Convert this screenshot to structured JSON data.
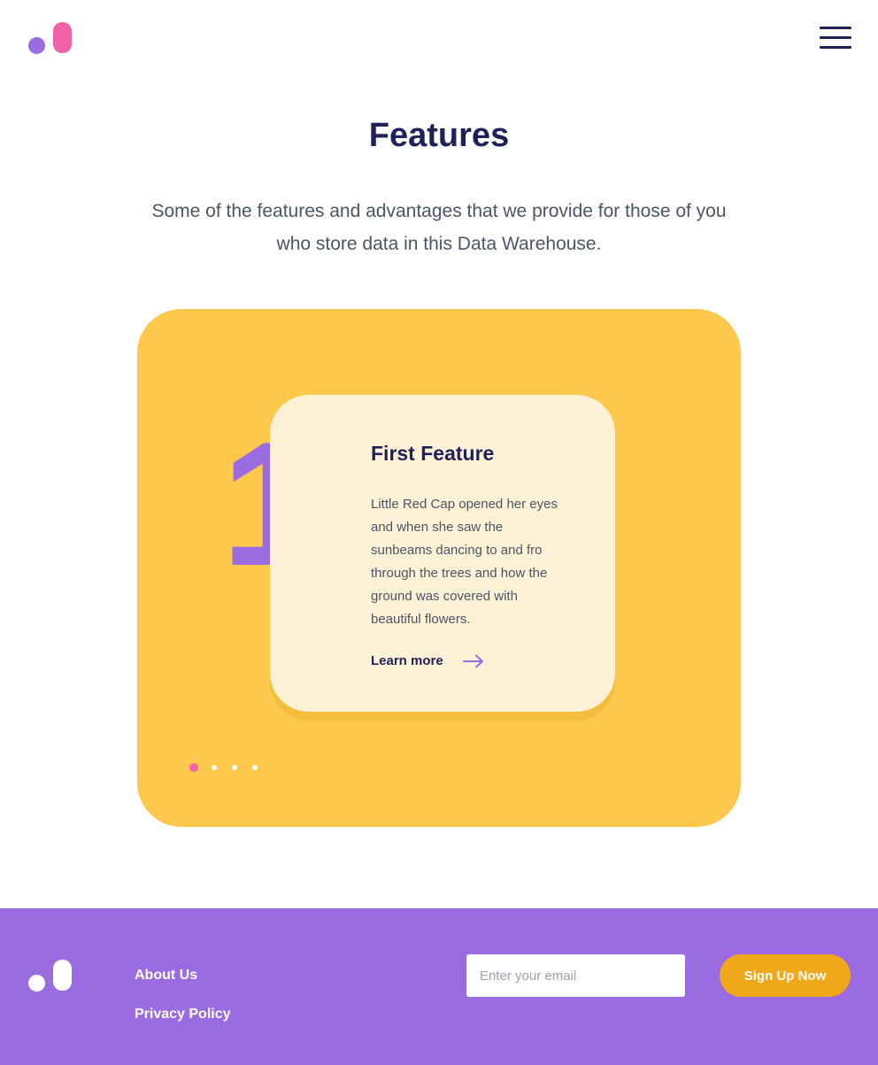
{
  "header": {
    "logo_icon": "brand-logo-icon",
    "menu_icon": "hamburger-menu-icon"
  },
  "features": {
    "title": "Features",
    "subtitle": "Some of the features and advantages that we provide for those of you who store data in this Data Warehouse.",
    "current_slide": {
      "number": "1",
      "title": "First Feature",
      "body": "Little Red Cap opened her eyes and when she saw the sunbeams dancing to and fro through the trees and how the ground was covered with beautiful flowers.",
      "link_label": "Learn more",
      "link_icon": "arrow-right-icon"
    },
    "pager": {
      "total": 4,
      "active_index": 0
    }
  },
  "footer": {
    "logo_icon": "brand-logo-icon",
    "links": {
      "about": "About Us",
      "privacy": "Privacy Policy"
    },
    "email": {
      "placeholder": "Enter your email",
      "value": ""
    },
    "signup_label": "Sign Up Now"
  },
  "colors": {
    "navy": "#1f2258",
    "purple": "#9b6be2",
    "pink": "#f063a8",
    "yellow": "#fec84d",
    "card": "#fef1d6",
    "orange_button": "#f0a81a"
  }
}
